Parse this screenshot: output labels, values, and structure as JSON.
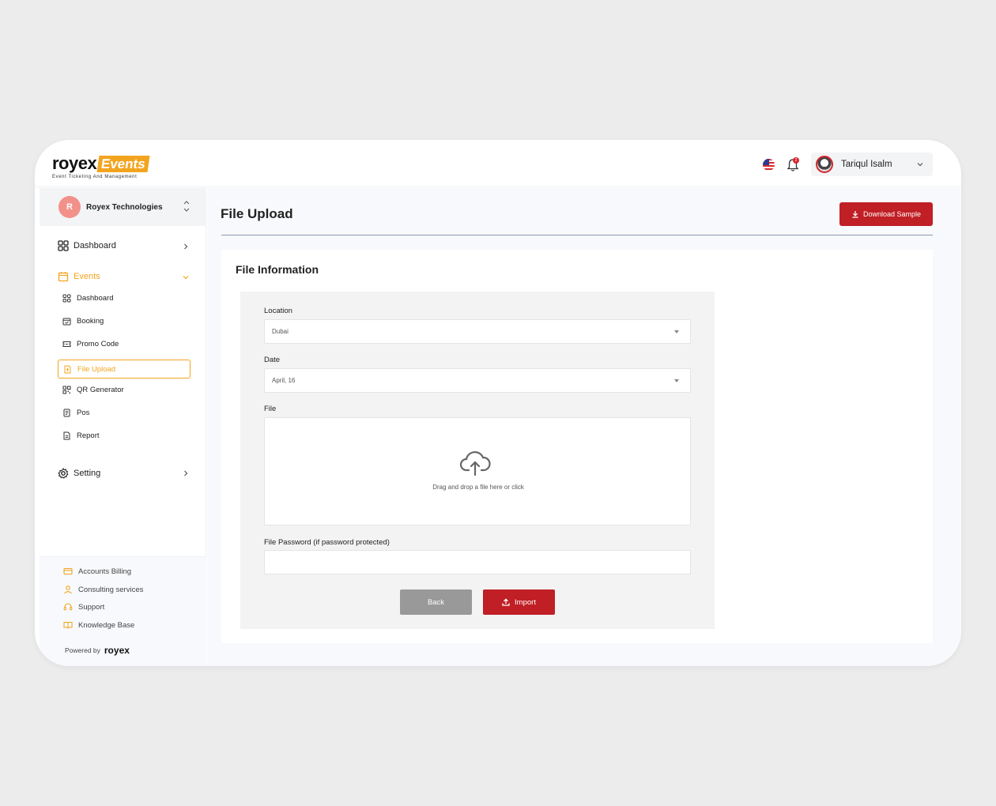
{
  "header": {
    "logo_brand": "royex",
    "logo_events": "Events",
    "logo_tagline": "Event Ticketing And Management",
    "notification_count": "2",
    "user_name": "Tariqul Isalm"
  },
  "sidebar": {
    "org_initial": "R",
    "org_name": "Royex Technologies",
    "nav": {
      "dashboard": "Dashboard",
      "events": "Events",
      "setting": "Setting"
    },
    "events_sub": [
      {
        "label": "Dashboard",
        "icon": "grid-icon"
      },
      {
        "label": "Booking",
        "icon": "calendar-check-icon"
      },
      {
        "label": "Promo Code",
        "icon": "ticket-icon"
      },
      {
        "label": "File Upload",
        "icon": "file-icon",
        "active": true
      },
      {
        "label": "QR Generator",
        "icon": "qr-icon"
      },
      {
        "label": "Pos",
        "icon": "receipt-icon"
      },
      {
        "label": "Report",
        "icon": "report-icon"
      }
    ],
    "footer": [
      {
        "label": "Accounts Billing",
        "icon": "credit-card-icon"
      },
      {
        "label": "Consulting services",
        "icon": "user-icon"
      },
      {
        "label": "Support",
        "icon": "headset-icon"
      },
      {
        "label": "Knowledge Base",
        "icon": "book-icon"
      }
    ],
    "powered_by": "Powered by",
    "powered_logo": "royex"
  },
  "main": {
    "page_title": "File Upload",
    "download_button": "Download Sample",
    "card_title": "File Information",
    "form": {
      "location_label": "Location",
      "location_value": "Dubai",
      "date_label": "Date",
      "date_value": "April, 16",
      "file_label": "File",
      "dropzone_text": "Drag and drop a file here or click",
      "password_label": "File Password (if password protected)",
      "back_button": "Back",
      "import_button": "Import"
    }
  },
  "colors": {
    "accent_red": "#c01f25",
    "accent_orange": "#f3a41f"
  }
}
